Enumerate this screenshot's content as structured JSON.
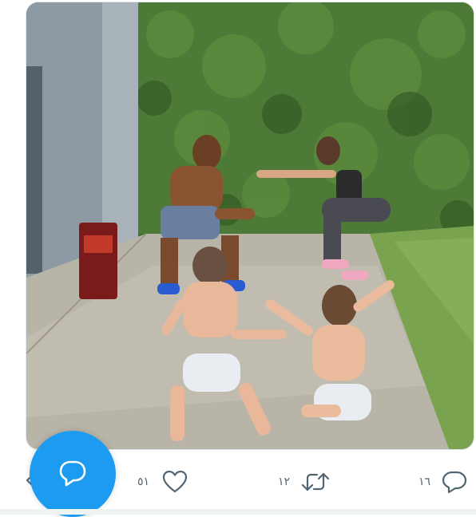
{
  "media": {
    "kind": "video-still",
    "description_icon": "video-thumbnail"
  },
  "actions": {
    "reply": {
      "icon": "reply-icon",
      "count": "١٦"
    },
    "retweet": {
      "icon": "retweet-icon",
      "count": "١٢"
    },
    "like": {
      "icon": "heart-icon",
      "count": "٥١"
    }
  },
  "fab": {
    "icon": "compose-reply-icon",
    "color": "#1d9bf0"
  },
  "colors": {
    "icon": "#536471",
    "accent": "#1d9bf0",
    "divider": "#eff3f4"
  }
}
